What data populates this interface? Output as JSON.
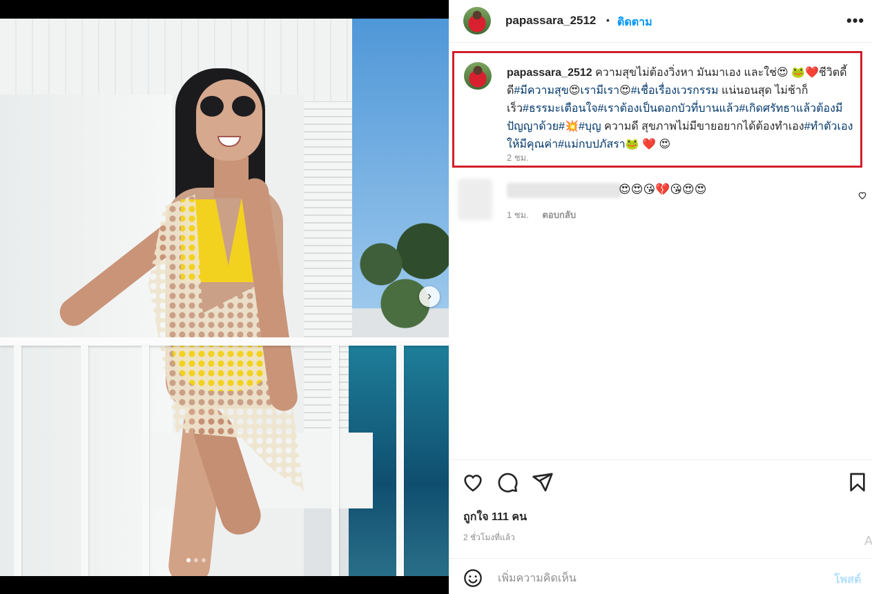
{
  "post": {
    "username": "papassara_2512",
    "separator": "•",
    "follow_label": "ติดตาม",
    "more_label": "•••"
  },
  "caption": {
    "username": "papassara_2512",
    "parts": [
      {
        "type": "text",
        "text": " ความสุขไม่ต้องวิ่งหา มันมาเอง และใช่😍 🐸❤️ชีวิตดี้ดี"
      },
      {
        "type": "tag",
        "text": "#มีความสุข"
      },
      {
        "type": "text",
        "text": "😍"
      },
      {
        "type": "tag",
        "text": "เรามีเรา"
      },
      {
        "type": "text",
        "text": "😍"
      },
      {
        "type": "tag",
        "text": "#เชื่อเรื่องเวรกรรม"
      },
      {
        "type": "text",
        "text": " แน่นอนสุด ไม่ช้าก็เร็ว"
      },
      {
        "type": "tag",
        "text": "#ธรรมะเตือนใจ"
      },
      {
        "type": "tag",
        "text": "#เราต้องเป็นดอกบัวที่บานแล้ว"
      },
      {
        "type": "tag",
        "text": "#เกิดศรัทธาแล้วต้องมีปัญญาด้วย"
      },
      {
        "type": "tag",
        "text": "#"
      },
      {
        "type": "text",
        "text": "💥"
      },
      {
        "type": "tag",
        "text": "#บุญ"
      },
      {
        "type": "text",
        "text": " ความดี สุขภาพไม่มีขายอยากได้ต้องทำเอง"
      },
      {
        "type": "tag",
        "text": "#ทำตัวเองให้มีคุณค่า"
      },
      {
        "type": "tag",
        "text": "#แม่กบปภัสรา"
      },
      {
        "type": "text",
        "text": "🐸 ❤️ 😍"
      }
    ],
    "time": "2 ชม."
  },
  "comment": {
    "text": "😍😍😘💔😘😍😍",
    "time": "1 ชม.",
    "reply_label": "ตอบกลับ"
  },
  "actions": {
    "likes": "ถูกใจ 111 คน",
    "post_time": "2 ชั่วโมงที่แล้ว"
  },
  "add_comment": {
    "placeholder": "เพิ่มความคิดเห็น",
    "post_label": "โพสต์",
    "edge_letter": "A"
  },
  "colors": {
    "link_blue": "#0095f6",
    "hashtag": "#00376b",
    "highlight_border": "#d21e2a",
    "muted": "#8e8e8e"
  },
  "icons": [
    "carousel-next-icon",
    "more-icon",
    "heart-icon",
    "comment-icon",
    "share-icon",
    "bookmark-icon",
    "emoji-icon",
    "small-heart-icon"
  ]
}
